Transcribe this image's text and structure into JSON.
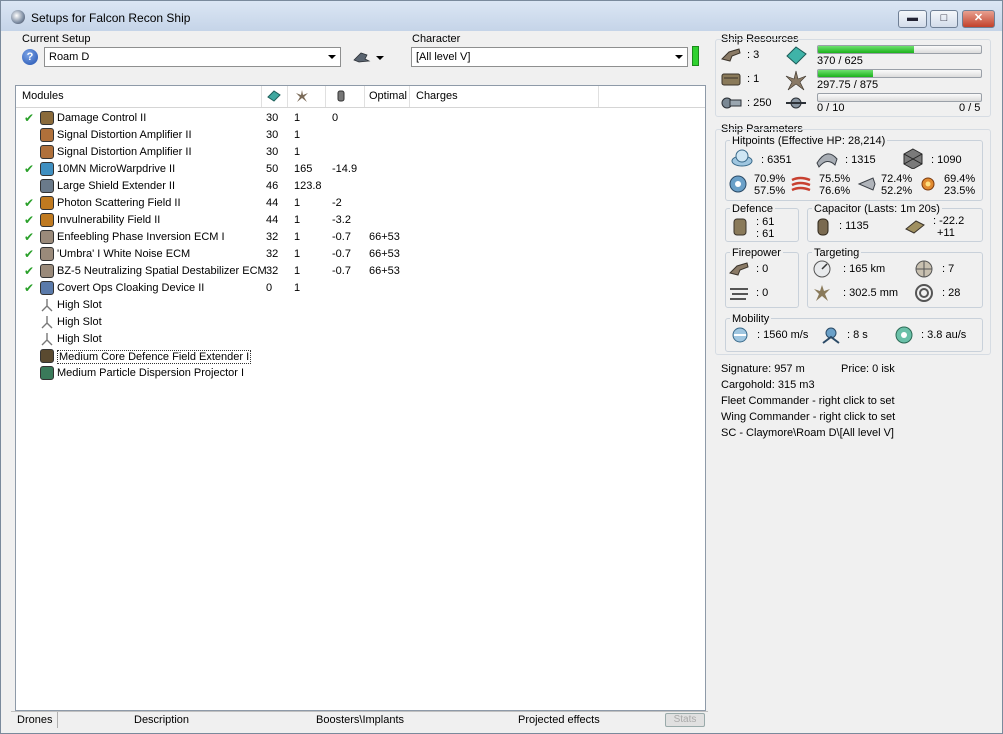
{
  "window": {
    "title": "Setups for Falcon Recon Ship",
    "min_icon": "minimize-icon",
    "max_icon": "maximize-icon",
    "close_icon": "close-icon",
    "min_label": "▬",
    "max_label": "□",
    "close_label": "✕"
  },
  "setup": {
    "label": "Current Setup",
    "value": "Roam D",
    "help_label": "?"
  },
  "character": {
    "label": "Character",
    "value": "[All level V]",
    "status_color": "#2fd12f"
  },
  "modules": {
    "columns": [
      "Modules",
      "Optimal",
      "Charges"
    ],
    "header_icons": [
      "cpu-icon",
      "powergrid-icon",
      "capacitor-icon"
    ],
    "rows": [
      {
        "fitted": true,
        "name": "Damage Control II",
        "cpu": "30",
        "pg": "1",
        "cap": "0",
        "optimal": "",
        "icon": "damage-control-icon",
        "color": "#8a6a3a"
      },
      {
        "fitted": false,
        "name": "Signal Distortion Amplifier II",
        "cpu": "30",
        "pg": "1",
        "cap": "",
        "optimal": "",
        "icon": "amplifier-icon",
        "color": "#b0703a"
      },
      {
        "fitted": false,
        "name": "Signal Distortion Amplifier II",
        "cpu": "30",
        "pg": "1",
        "cap": "",
        "optimal": "",
        "icon": "amplifier-icon",
        "color": "#b0703a"
      },
      {
        "fitted": true,
        "name": "10MN MicroWarpdrive II",
        "cpu": "50",
        "pg": "165",
        "cap": "-14.9",
        "optimal": "",
        "icon": "microwarpdrive-icon",
        "color": "#3f8fc0"
      },
      {
        "fitted": false,
        "name": "Large Shield Extender II",
        "cpu": "46",
        "pg": "123.8",
        "cap": "",
        "optimal": "",
        "icon": "shield-extender-icon",
        "color": "#6a7a8a"
      },
      {
        "fitted": true,
        "name": "Photon Scattering Field II",
        "cpu": "44",
        "pg": "1",
        "cap": "-2",
        "optimal": "",
        "icon": "hardener-icon",
        "color": "#c07a20"
      },
      {
        "fitted": true,
        "name": "Invulnerability Field II",
        "cpu": "44",
        "pg": "1",
        "cap": "-3.2",
        "optimal": "",
        "icon": "hardener-icon",
        "color": "#c07a20"
      },
      {
        "fitted": true,
        "name": "Enfeebling Phase Inversion ECM I",
        "cpu": "32",
        "pg": "1",
        "cap": "-0.7",
        "optimal": "66+53",
        "icon": "ecm-icon",
        "color": "#9a8a7a"
      },
      {
        "fitted": true,
        "name": "'Umbra' I White Noise ECM",
        "cpu": "32",
        "pg": "1",
        "cap": "-0.7",
        "optimal": "66+53",
        "icon": "ecm-icon",
        "color": "#9a8a7a"
      },
      {
        "fitted": true,
        "name": "BZ-5 Neutralizing Spatial Destabilizer ECM",
        "cpu": "32",
        "pg": "1",
        "cap": "-0.7",
        "optimal": "66+53",
        "icon": "ecm-icon",
        "color": "#9a8a7a"
      },
      {
        "fitted": true,
        "name": "Covert Ops Cloaking Device II",
        "cpu": "0",
        "pg": "1",
        "cap": "",
        "optimal": "",
        "icon": "cloak-icon",
        "color": "#5a7aaa"
      },
      {
        "fitted": false,
        "name": "High Slot",
        "cpu": "",
        "pg": "",
        "cap": "",
        "optimal": "",
        "icon": "empty-slot-icon",
        "color": "#ffffff"
      },
      {
        "fitted": false,
        "name": "High Slot",
        "cpu": "",
        "pg": "",
        "cap": "",
        "optimal": "",
        "icon": "empty-slot-icon",
        "color": "#ffffff"
      },
      {
        "fitted": false,
        "name": "High Slot",
        "cpu": "",
        "pg": "",
        "cap": "",
        "optimal": "",
        "icon": "empty-slot-icon",
        "color": "#ffffff"
      },
      {
        "fitted": false,
        "name": "Medium Core Defence Field Extender I",
        "cpu": "",
        "pg": "",
        "cap": "",
        "optimal": "",
        "icon": "rig-icon",
        "color": "#5a4a30",
        "selected": true
      },
      {
        "fitted": false,
        "name": "Medium Particle Dispersion Projector I",
        "cpu": "",
        "pg": "",
        "cap": "",
        "optimal": "",
        "icon": "rig-icon",
        "color": "#3a7a5a"
      }
    ]
  },
  "bottom_tabs": [
    "Drones",
    "Description",
    "Boosters\\Implants",
    "Projected effects",
    "Stats"
  ],
  "resources": {
    "title": "Ship Resources",
    "slots": [
      {
        "icon": "turret-hardpoint-icon",
        "value": ": 3"
      },
      {
        "icon": "launcher-hardpoint-icon",
        "value": ": 1"
      },
      {
        "icon": "calibration-icon",
        "value": ": 250"
      }
    ],
    "cpu": {
      "icon": "cpu-icon",
      "text": "370 / 625",
      "fraction": 0.592
    },
    "power": {
      "icon": "powergrid-icon",
      "text": "297.75 / 875",
      "fraction": 0.34
    },
    "drone": {
      "icon": "drone-bay-icon",
      "text_left": "0 / 10",
      "text_right": "0 / 5",
      "fraction": 0
    }
  },
  "parameters": {
    "title": "Ship Parameters",
    "hitpoints": {
      "title": "Hitpoints (Effective HP: 28,214)",
      "shield": ": 6351",
      "armor": ": 1315",
      "structure": ": 1090",
      "resists": [
        {
          "icon": "em-resist-icon",
          "a": "70.9%",
          "b": "57.5%"
        },
        {
          "icon": "thermal-resist-icon",
          "a": "75.5%",
          "b": "76.6%"
        },
        {
          "icon": "kinetic-resist-icon",
          "a": "72.4%",
          "b": "52.2%"
        },
        {
          "icon": "explosive-resist-icon",
          "a": "69.4%",
          "b": "23.5%"
        }
      ]
    },
    "defence": {
      "title": "Defence",
      "a": ": 61",
      "b": ": 61"
    },
    "capacitor": {
      "title": "Capacitor (Lasts: 1m 20s)",
      "amount": ": 1135",
      "rate_a": ": -22.2",
      "rate_b": "+11"
    },
    "firepower": {
      "title": "Firepower",
      "turret": ": 0",
      "missile": ": 0"
    },
    "targeting": {
      "title": "Targeting",
      "range": ": 165 km",
      "targets": ": 7",
      "scan": ": 302.5 mm",
      "sensor": ": 28"
    },
    "mobility": {
      "title": "Mobility",
      "velocity": ": 1560 m/s",
      "align": ": 8 s",
      "warp": ": 3.8 au/s"
    }
  },
  "info": {
    "signature": "Signature: 957 m",
    "price": "Price: 0 isk",
    "cargo": "Cargohold: 315 m3",
    "fleet": "Fleet Commander - right click to set",
    "wing": "Wing Commander - right click to set",
    "path": "SC - Claymore\\Roam D\\[All level V]"
  }
}
